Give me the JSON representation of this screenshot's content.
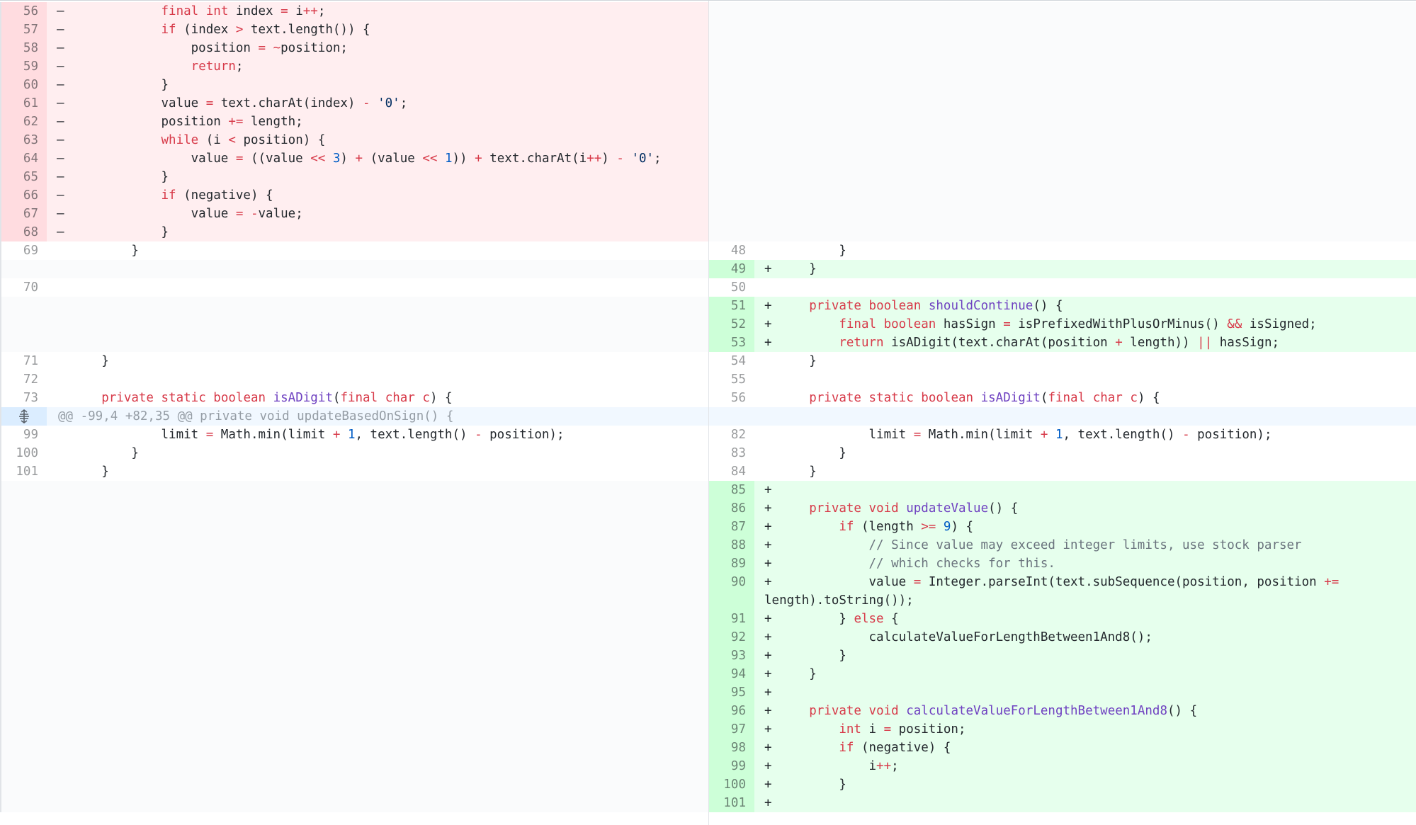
{
  "diff": {
    "hunk_header": "@@ -99,4 +82,35 @@ private void updateBasedOnSign() {",
    "rows": [
      {
        "t": "del",
        "l": "56",
        "lc": "            final int index = i++;"
      },
      {
        "t": "del",
        "l": "57",
        "lc": "            if (index > text.length()) {"
      },
      {
        "t": "del",
        "l": "58",
        "lc": "                position = ~position;"
      },
      {
        "t": "del",
        "l": "59",
        "lc": "                return;"
      },
      {
        "t": "del",
        "l": "60",
        "lc": "            }"
      },
      {
        "t": "del",
        "l": "61",
        "lc": "            value = text.charAt(index) - '0';"
      },
      {
        "t": "del",
        "l": "62",
        "lc": "            position += length;"
      },
      {
        "t": "del",
        "l": "63",
        "lc": "            while (i < position) {"
      },
      {
        "t": "del",
        "l": "64",
        "lc": "                value = ((value << 3) + (value << 1)) + text.charAt(i++) - '0';"
      },
      {
        "t": "del",
        "l": "65",
        "lc": "            }"
      },
      {
        "t": "del",
        "l": "66",
        "lc": "            if (negative) {"
      },
      {
        "t": "del",
        "l": "67",
        "lc": "                value = -value;"
      },
      {
        "t": "del",
        "l": "68",
        "lc": "            }"
      },
      {
        "t": "ctx",
        "l": "69",
        "lc": "        }",
        "r": "48",
        "rc": "        }"
      },
      {
        "t": "add",
        "r": "49",
        "rc": "    }"
      },
      {
        "t": "ctx",
        "l": "70",
        "lc": "",
        "r": "50",
        "rc": ""
      },
      {
        "t": "add",
        "r": "51",
        "rc": "    private boolean shouldContinue() {"
      },
      {
        "t": "add",
        "r": "52",
        "rc": "        final boolean hasSign = isPrefixedWithPlusOrMinus() && isSigned;"
      },
      {
        "t": "add",
        "r": "53",
        "rc": "        return isADigit(text.charAt(position + length)) || hasSign;"
      },
      {
        "t": "ctx",
        "l": "71",
        "lc": "    }",
        "r": "54",
        "rc": "    }"
      },
      {
        "t": "ctx",
        "l": "72",
        "lc": "",
        "r": "55",
        "rc": ""
      },
      {
        "t": "ctx",
        "l": "73",
        "lc": "    private static boolean isADigit(final char c) {",
        "r": "56",
        "rc": "    private static boolean isADigit(final char c) {"
      },
      {
        "t": "hunk"
      },
      {
        "t": "ctx",
        "l": "99",
        "lc": "            limit = Math.min(limit + 1, text.length() - position);",
        "r": "82",
        "rc": "            limit = Math.min(limit + 1, text.length() - position);"
      },
      {
        "t": "ctx",
        "l": "100",
        "lc": "        }",
        "r": "83",
        "rc": "        }"
      },
      {
        "t": "ctx",
        "l": "101",
        "lc": "    }",
        "r": "84",
        "rc": "    }"
      },
      {
        "t": "add",
        "r": "85",
        "rc": ""
      },
      {
        "t": "add",
        "r": "86",
        "rc": "    private void updateValue() {"
      },
      {
        "t": "add",
        "r": "87",
        "rc": "        if (length >= 9) {"
      },
      {
        "t": "add",
        "r": "88",
        "rc": "            // Since value may exceed integer limits, use stock parser"
      },
      {
        "t": "add",
        "r": "89",
        "rc": "            // which checks for this."
      },
      {
        "t": "add",
        "r": "90",
        "rc": "            value = Integer.parseInt(text.subSequence(position, position += length).toString());",
        "wrap": true
      },
      {
        "t": "add",
        "r": "91",
        "rc": "        } else {"
      },
      {
        "t": "add",
        "r": "92",
        "rc": "            calculateValueForLengthBetween1And8();"
      },
      {
        "t": "add",
        "r": "93",
        "rc": "        }"
      },
      {
        "t": "add",
        "r": "94",
        "rc": "    }"
      },
      {
        "t": "add",
        "r": "95",
        "rc": ""
      },
      {
        "t": "add",
        "r": "96",
        "rc": "    private void calculateValueForLengthBetween1And8() {"
      },
      {
        "t": "add",
        "r": "97",
        "rc": "        int i = position;"
      },
      {
        "t": "add",
        "r": "98",
        "rc": "        if (negative) {"
      },
      {
        "t": "add",
        "r": "99",
        "rc": "            i++;"
      },
      {
        "t": "add",
        "r": "100",
        "rc": "        }"
      },
      {
        "t": "add",
        "r": "101",
        "rc": ""
      }
    ],
    "del_marker": "–",
    "add_marker": "+",
    "expand_icon": "unfold-icon"
  }
}
